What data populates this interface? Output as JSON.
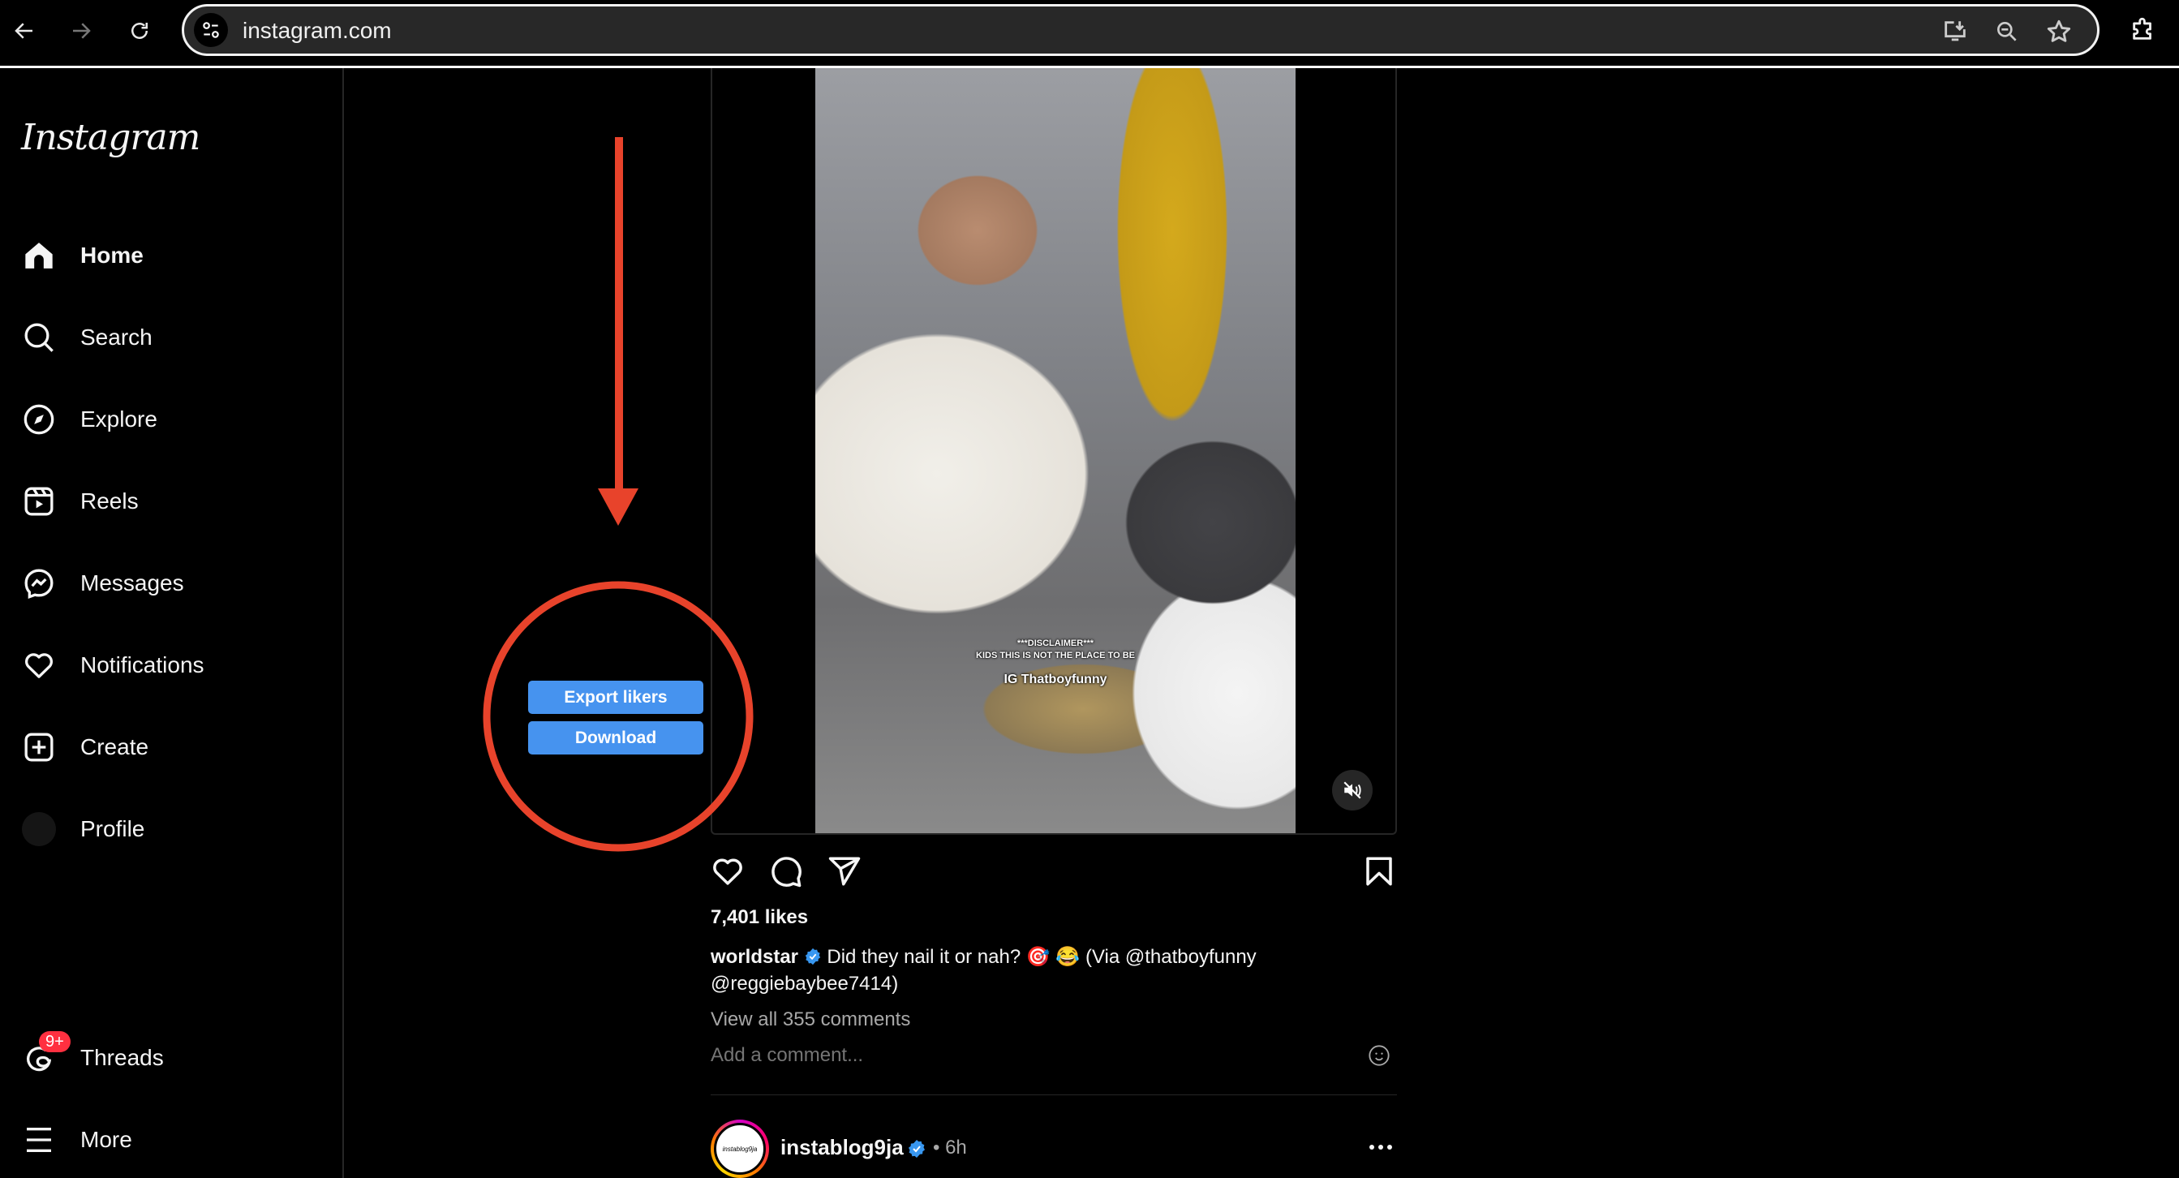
{
  "browser": {
    "url": "instagram.com",
    "icons": {
      "back": "arrow-left-icon",
      "forward": "arrow-right-icon",
      "reload": "reload-icon",
      "site_info": "tune-icon",
      "install": "install-app-icon",
      "zoom": "zoom-out-icon",
      "bookmark": "star-icon",
      "extensions": "puzzle-icon"
    }
  },
  "sidebar": {
    "logo": "Instagram",
    "items": [
      {
        "label": "Home",
        "icon": "home-icon",
        "active": true
      },
      {
        "label": "Search",
        "icon": "search-icon"
      },
      {
        "label": "Explore",
        "icon": "compass-icon"
      },
      {
        "label": "Reels",
        "icon": "reels-icon"
      },
      {
        "label": "Messages",
        "icon": "messenger-icon"
      },
      {
        "label": "Notifications",
        "icon": "heart-icon"
      },
      {
        "label": "Create",
        "icon": "plus-square-icon"
      },
      {
        "label": "Profile",
        "icon": "avatar-icon"
      }
    ],
    "bottom_items": [
      {
        "label": "Threads",
        "icon": "threads-icon",
        "badge": "9+"
      },
      {
        "label": "More",
        "icon": "menu-icon"
      }
    ]
  },
  "extension": {
    "export_likers_label": "Export likers",
    "download_label": "Download",
    "button_color": "#4693ef"
  },
  "annotation": {
    "color": "#e8432b",
    "shapes": [
      "arrow-down",
      "circle"
    ]
  },
  "post": {
    "video_overlay": {
      "line1": "***DISCLAIMER***",
      "line2": "KIDS THIS IS NOT THE PLACE TO BE",
      "line3": "IG Thatboyfunny"
    },
    "muted": true,
    "likes": "7,401 likes",
    "author": "worldstar",
    "verified": true,
    "caption": "Did they nail it or nah? 🎯 😂 (Via @thatboyfunny @reggiebaybee7414)",
    "view_comments": "View all 355 comments",
    "comment_placeholder": "Add a comment..."
  },
  "next_post": {
    "author": "instablog9ja",
    "avatar_text": "instablog9ja",
    "verified": true,
    "time": "• 6h"
  }
}
